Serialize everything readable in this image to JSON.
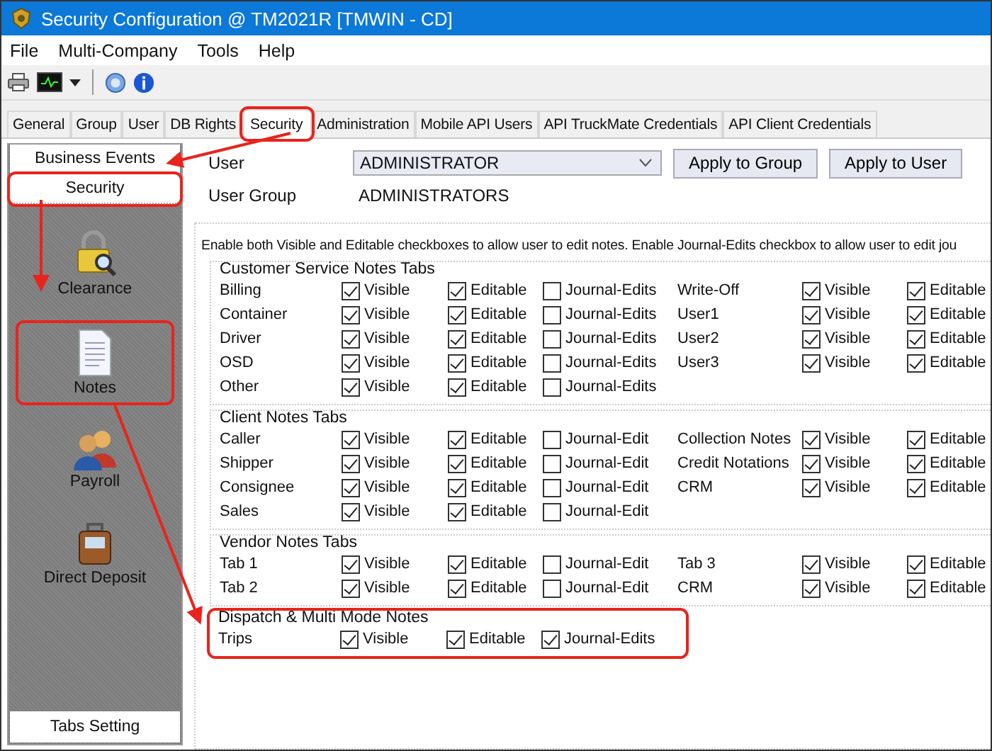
{
  "window": {
    "title": "Security Configuration @ TM2021R [TMWIN - CD]"
  },
  "menu": [
    "File",
    "Multi-Company",
    "Tools",
    "Help"
  ],
  "tabs": [
    {
      "label": "General",
      "selected": false,
      "highlighted": false
    },
    {
      "label": "Group",
      "selected": false,
      "highlighted": false
    },
    {
      "label": "User",
      "selected": false,
      "highlighted": false
    },
    {
      "label": "DB Rights",
      "selected": false,
      "highlighted": false
    },
    {
      "label": "Security",
      "selected": true,
      "highlighted": true
    },
    {
      "label": "Administration",
      "selected": false,
      "highlighted": false
    },
    {
      "label": "Mobile API Users",
      "selected": false,
      "highlighted": false
    },
    {
      "label": "API TruckMate Credentials",
      "selected": false,
      "highlighted": false
    },
    {
      "label": "API Client Credentials",
      "selected": false,
      "highlighted": false
    }
  ],
  "sidebar": {
    "panels": [
      {
        "label": "Business Events",
        "highlighted": false
      },
      {
        "label": "Security",
        "highlighted": true
      }
    ],
    "items": [
      {
        "label": "Clearance",
        "kind": "lock",
        "highlighted": false
      },
      {
        "label": "Notes",
        "kind": "document",
        "highlighted": true
      },
      {
        "label": "Payroll",
        "kind": "people",
        "highlighted": false
      },
      {
        "label": "Direct Deposit",
        "kind": "case",
        "highlighted": false
      }
    ],
    "footer": "Tabs Setting"
  },
  "user": {
    "label": "User",
    "value": "ADMINISTRATOR",
    "group_label": "User Group",
    "group_value": "ADMINISTRATORS"
  },
  "buttons": [
    "Apply to Group",
    "Apply to User"
  ],
  "instructions": "Enable both Visible and Editable checkboxes to allow user to edit notes. Enable Journal-Edits checkbox to allow user to edit jou",
  "sections": [
    {
      "title": "Customer Service Notes Tabs",
      "highlighted": false,
      "columns": [
        [
          {
            "label": "Billing",
            "boxes": [
              {
                "label": "Visible",
                "checked": true
              },
              {
                "label": "Editable",
                "checked": true
              },
              {
                "label": "Journal-Edits",
                "checked": false
              }
            ]
          },
          {
            "label": "Container",
            "boxes": [
              {
                "label": "Visible",
                "checked": true
              },
              {
                "label": "Editable",
                "checked": true
              },
              {
                "label": "Journal-Edits",
                "checked": false
              }
            ]
          },
          {
            "label": "Driver",
            "boxes": [
              {
                "label": "Visible",
                "checked": true
              },
              {
                "label": "Editable",
                "checked": true
              },
              {
                "label": "Journal-Edits",
                "checked": false
              }
            ]
          },
          {
            "label": "OSD",
            "boxes": [
              {
                "label": "Visible",
                "checked": true
              },
              {
                "label": "Editable",
                "checked": true
              },
              {
                "label": "Journal-Edits",
                "checked": false
              }
            ]
          },
          {
            "label": "Other",
            "boxes": [
              {
                "label": "Visible",
                "checked": true
              },
              {
                "label": "Editable",
                "checked": true
              },
              {
                "label": "Journal-Edits",
                "checked": false
              }
            ]
          }
        ],
        [
          {
            "label": "Write-Off",
            "boxes": [
              {
                "label": "Visible",
                "checked": true
              },
              {
                "label": "Editable",
                "checked": true
              }
            ]
          },
          {
            "label": "User1",
            "boxes": [
              {
                "label": "Visible",
                "checked": true
              },
              {
                "label": "Editable",
                "checked": true
              }
            ]
          },
          {
            "label": "User2",
            "boxes": [
              {
                "label": "Visible",
                "checked": true
              },
              {
                "label": "Editable",
                "checked": true
              }
            ]
          },
          {
            "label": "User3",
            "boxes": [
              {
                "label": "Visible",
                "checked": true
              },
              {
                "label": "Editable",
                "checked": true
              }
            ]
          }
        ]
      ]
    },
    {
      "title": "Client Notes Tabs",
      "highlighted": false,
      "columns": [
        [
          {
            "label": "Caller",
            "boxes": [
              {
                "label": "Visible",
                "checked": true
              },
              {
                "label": "Editable",
                "checked": true
              },
              {
                "label": "Journal-Edit",
                "checked": false
              }
            ]
          },
          {
            "label": "Shipper",
            "boxes": [
              {
                "label": "Visible",
                "checked": true
              },
              {
                "label": "Editable",
                "checked": true
              },
              {
                "label": "Journal-Edit",
                "checked": false
              }
            ]
          },
          {
            "label": "Consignee",
            "boxes": [
              {
                "label": "Visible",
                "checked": true
              },
              {
                "label": "Editable",
                "checked": true
              },
              {
                "label": "Journal-Edit",
                "checked": false
              }
            ]
          },
          {
            "label": "Sales",
            "boxes": [
              {
                "label": "Visible",
                "checked": true
              },
              {
                "label": "Editable",
                "checked": true
              },
              {
                "label": "Journal-Edit",
                "checked": false
              }
            ]
          }
        ],
        [
          {
            "label": "Collection Notes",
            "boxes": [
              {
                "label": "Visible",
                "checked": true
              },
              {
                "label": "Editable",
                "checked": true
              }
            ]
          },
          {
            "label": "Credit Notations",
            "boxes": [
              {
                "label": "Visible",
                "checked": true
              },
              {
                "label": "Editable",
                "checked": true
              }
            ]
          },
          {
            "label": "CRM",
            "boxes": [
              {
                "label": "Visible",
                "checked": true
              },
              {
                "label": "Editable",
                "checked": true
              }
            ]
          }
        ]
      ]
    },
    {
      "title": "Vendor Notes Tabs",
      "highlighted": false,
      "columns": [
        [
          {
            "label": "Tab 1",
            "boxes": [
              {
                "label": "Visible",
                "checked": true
              },
              {
                "label": "Editable",
                "checked": true
              },
              {
                "label": "Journal-Edit",
                "checked": false
              }
            ]
          },
          {
            "label": "Tab 2",
            "boxes": [
              {
                "label": "Visible",
                "checked": true
              },
              {
                "label": "Editable",
                "checked": true
              },
              {
                "label": "Journal-Edit",
                "checked": false
              }
            ]
          }
        ],
        [
          {
            "label": "Tab 3",
            "boxes": [
              {
                "label": "Visible",
                "checked": true
              },
              {
                "label": "Editable",
                "checked": true
              }
            ]
          },
          {
            "label": "CRM",
            "boxes": [
              {
                "label": "Visible",
                "checked": true
              },
              {
                "label": "Editable",
                "checked": true
              }
            ]
          }
        ]
      ]
    },
    {
      "title": "Dispatch & Multi Mode Notes",
      "highlighted": true,
      "columns": [
        [
          {
            "label": "Trips",
            "boxes": [
              {
                "label": "Visible",
                "checked": true
              },
              {
                "label": "Editable",
                "checked": true
              },
              {
                "label": "Journal-Edits",
                "checked": true
              }
            ]
          }
        ]
      ]
    }
  ]
}
